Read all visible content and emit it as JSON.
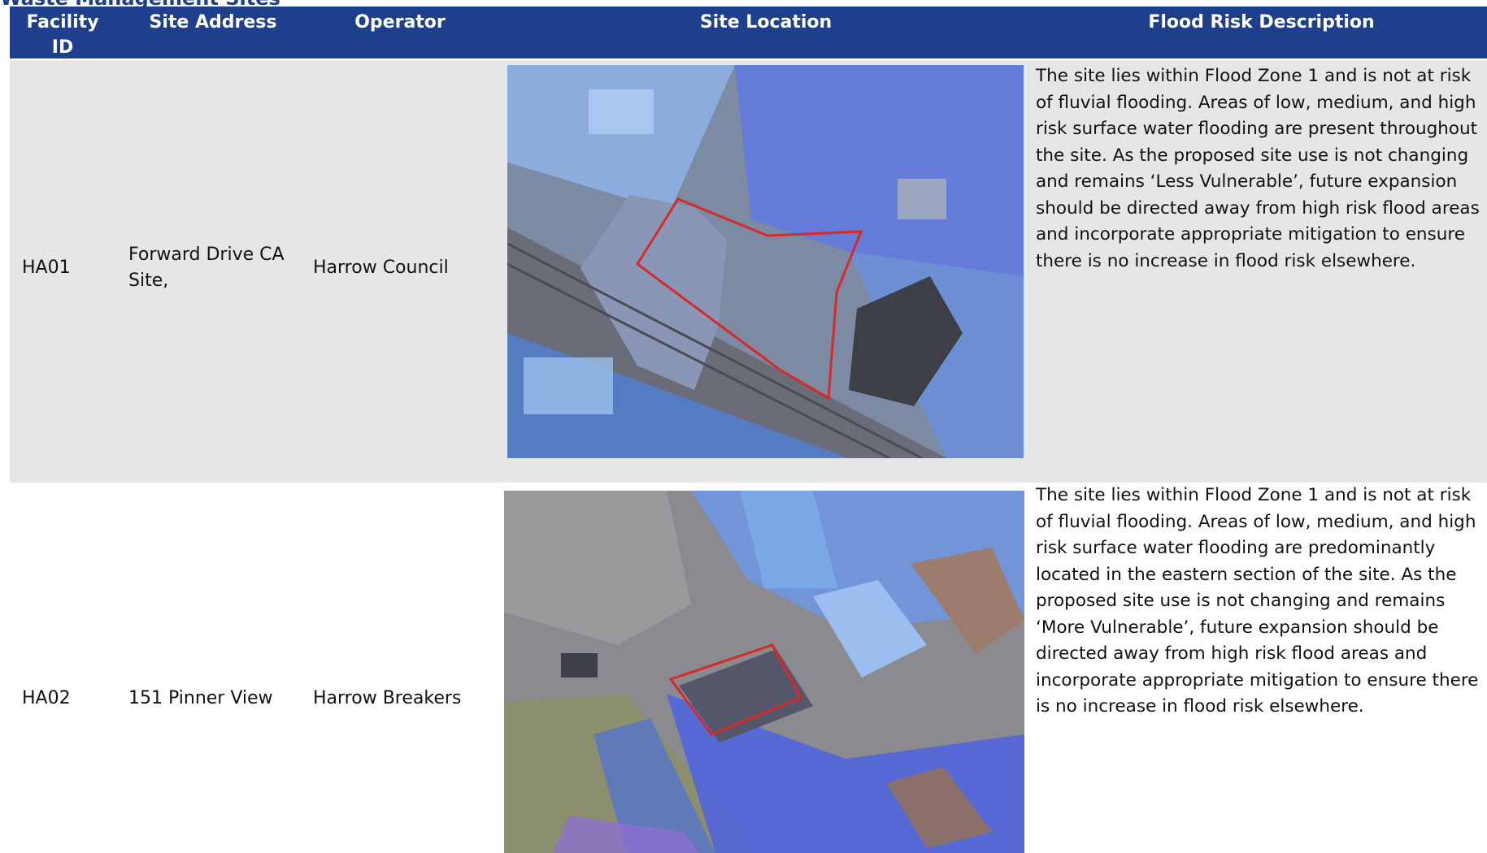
{
  "page": {
    "title_fragment": "Waste Management Sites"
  },
  "table": {
    "headers": {
      "facility_id": "Facility ID",
      "site_address": "Site Address",
      "operator": "Operator",
      "site_location": "Site Location",
      "flood_risk": "Flood Risk Description"
    },
    "rows": [
      {
        "facility_id": "HA01",
        "site_address": "Forward Drive CA Site,",
        "operator": "Harrow Council",
        "site_location_image": "aerial-map-with-flood-overlay",
        "flood_risk": "The site lies within Flood Zone 1 and is not at risk of fluvial flooding. Areas of low, medium, and high risk surface water flooding are present throughout the site. As the proposed site use is not changing and remains ‘Less Vulnerable’, future expansion should be directed away from high risk flood areas and incorporate appropriate mitigation to ensure there is no increase in flood risk elsewhere."
      },
      {
        "facility_id": "HA02",
        "site_address": "151 Pinner View",
        "operator": "Harrow Breakers",
        "site_location_image": "aerial-map-with-flood-overlay",
        "flood_risk": "The site lies within Flood Zone 1 and is not at risk of fluvial flooding. Areas of low, medium, and high risk surface water flooding are predominantly located in the eastern section of the site.  As the proposed site use is not changing and remains ‘More Vulnerable’, future expansion should be directed away from high risk flood areas and incorporate appropriate mitigation to ensure there is no increase in flood risk elsewhere."
      }
    ]
  },
  "colors": {
    "header_bg": "#1d3f8c",
    "row_alt_bg": "#e6e6e6",
    "boundary": "#d62a2a",
    "flood_overlay": "#4a6ff0"
  }
}
